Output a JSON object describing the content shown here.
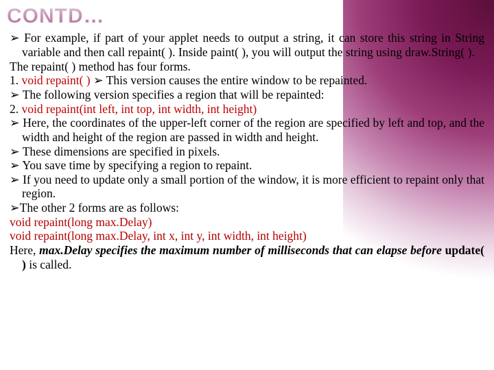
{
  "title": "CONTD…",
  "p1_prefix": "➢ ",
  "p1": "For example, if part of your applet needs to output a string, it can store this string in String variable and then call repaint( ). Inside paint( ), you will output the string using draw.String( ).",
  "p2": "The repaint( ) method has four forms.",
  "p3_num": " 1.",
  "p3_red": "void repaint( )",
  "p3_rest": " ➢ This version causes the entire window to be repainted.",
  "p4": "➢ The following version specifies a region that will be repainted:",
  "p5_num": " 2.",
  "p5_red": "void repaint(int left, int top, int width, int height)",
  "p6_prefix": "➢ ",
  "p6": "Here, the coordinates of the upper-left corner of the region are specified by left and top, and the width and height of the region are passed in width and height.",
  "p7": "➢ These dimensions are specified in pixels.",
  "p8": "➢ You save time by specifying a region to repaint.",
  "p9_prefix": "➢ ",
  "p9": "If you need to update only a small portion of the window, it is more efficient to repaint only that region.",
  "p10": "➢The other 2 forms are as follows:",
  "p11": " void repaint(long max.Delay)",
  "p12": " void repaint(long max.Delay, int x, int y, int width, int height)",
  "p13_a": "Here, ",
  "p13_b": "max.Delay specifies the maximum number of milliseconds that can elapse before ",
  "p13_c": "update( )",
  "p13_d": " is called."
}
